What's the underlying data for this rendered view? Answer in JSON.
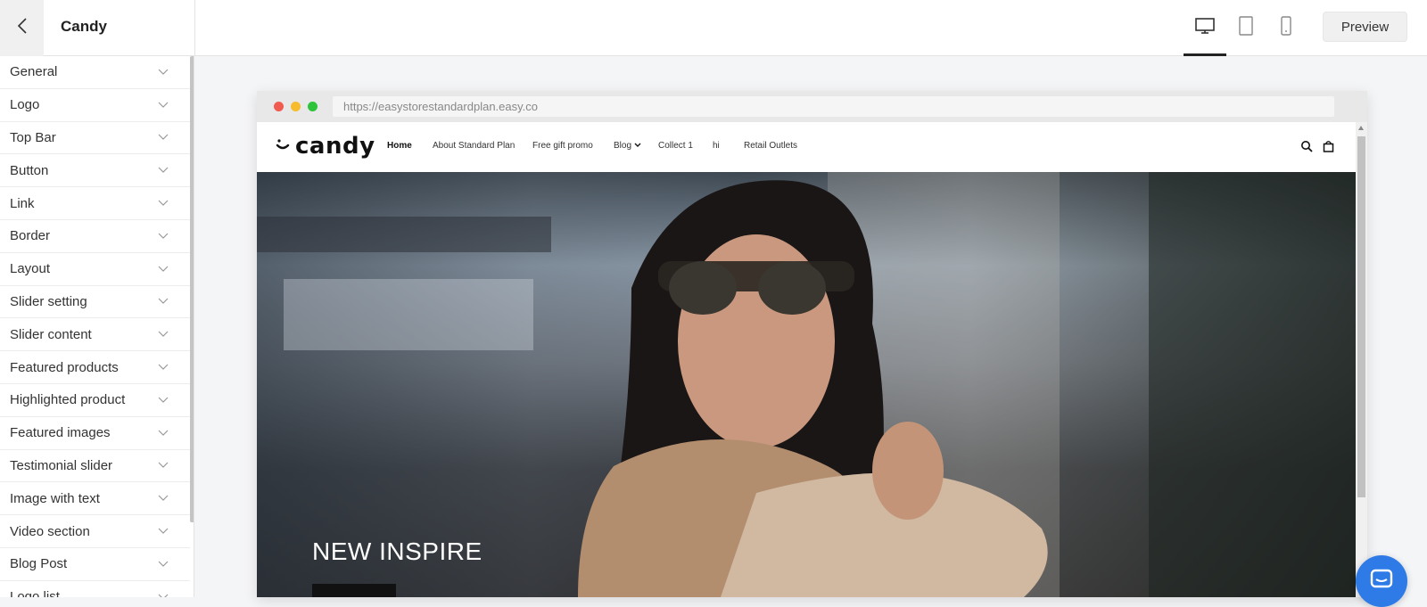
{
  "header": {
    "theme_title": "Candy",
    "preview_label": "Preview"
  },
  "sidebar": {
    "items": [
      {
        "label": "General"
      },
      {
        "label": "Logo"
      },
      {
        "label": "Top Bar"
      },
      {
        "label": "Button"
      },
      {
        "label": "Link"
      },
      {
        "label": "Border"
      },
      {
        "label": "Layout"
      },
      {
        "label": "Slider setting"
      },
      {
        "label": "Slider content"
      },
      {
        "label": "Featured products"
      },
      {
        "label": "Highlighted product"
      },
      {
        "label": "Featured images"
      },
      {
        "label": "Testimonial slider"
      },
      {
        "label": "Image with text"
      },
      {
        "label": "Video section"
      },
      {
        "label": "Blog Post"
      },
      {
        "label": "Logo list"
      }
    ]
  },
  "browser": {
    "url": "https://easystorestandardplan.easy.co"
  },
  "site": {
    "logo_text": "candy",
    "nav": [
      {
        "label": "Home"
      },
      {
        "label": "About Standard Plan"
      },
      {
        "label": "Free gift promo"
      },
      {
        "label": "Blog"
      },
      {
        "label": "Collect 1"
      },
      {
        "label": "hi"
      },
      {
        "label": "Retail Outlets"
      }
    ],
    "hero_title": "NEW INSPIRE"
  },
  "colors": {
    "chat_accent": "#2e7be8"
  }
}
